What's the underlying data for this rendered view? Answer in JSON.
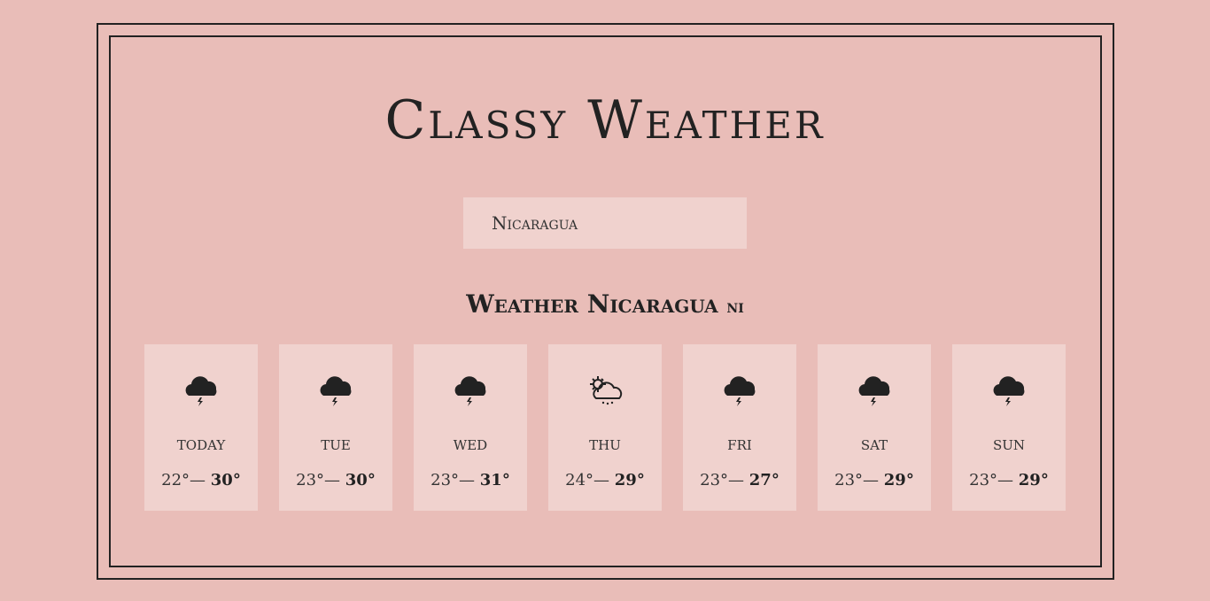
{
  "app": {
    "title": "Classy Weather"
  },
  "search": {
    "value": "Nicaragua"
  },
  "location_heading": {
    "label": "Weather Nicaragua",
    "country_code": "NI"
  },
  "forecast": [
    {
      "day": "Today",
      "min": "22°",
      "max": "30°",
      "icon": "thunderstorm-icon"
    },
    {
      "day": "Tue",
      "min": "23°",
      "max": "30°",
      "icon": "thunderstorm-icon"
    },
    {
      "day": "Wed",
      "min": "23°",
      "max": "31°",
      "icon": "thunderstorm-icon"
    },
    {
      "day": "Thu",
      "min": "24°",
      "max": "29°",
      "icon": "sun-cloud-rain-icon"
    },
    {
      "day": "Fri",
      "min": "23°",
      "max": "27°",
      "icon": "thunderstorm-icon"
    },
    {
      "day": "Sat",
      "min": "23°",
      "max": "29°",
      "icon": "thunderstorm-icon"
    },
    {
      "day": "Sun",
      "min": "23°",
      "max": "29°",
      "icon": "thunderstorm-icon"
    }
  ],
  "separator": "—",
  "colors": {
    "background": "#e9bdb8",
    "card": "#f0d2ce",
    "ink": "#222222"
  }
}
